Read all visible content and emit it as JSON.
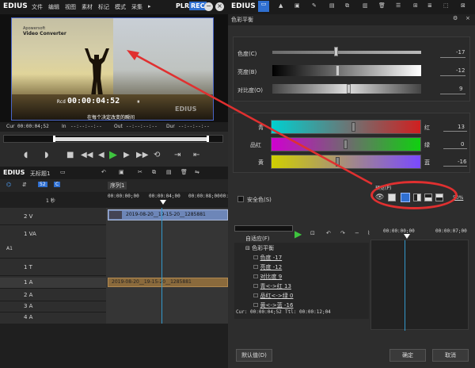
{
  "left_menu": {
    "brand": "EDIUS",
    "items": [
      "文件",
      "编辑",
      "视图",
      "素材",
      "标记",
      "模式",
      "采集"
    ],
    "more": "▸",
    "plr": "PLR",
    "rec": "REC"
  },
  "preview": {
    "wm1": "Apowersoft",
    "wm2": "Video Converter",
    "subtitle": "在每个决定改变的瞬间",
    "rcd": "Rcd",
    "tc": "00:00:04:52",
    "pause": "⏸",
    "logo": "EDIUS"
  },
  "timecodes": {
    "cur_l": "Cur",
    "cur": "00:00:04;52",
    "in_l": "In",
    "in": "--:--:--:--",
    "out_l": "Out",
    "out": "--:--:--:--",
    "dur_l": "Dur",
    "dur": "--:--:--:--"
  },
  "tl": {
    "brand": "EDIUS",
    "name": "无标题1",
    "seq": "序列1",
    "scale": "1 秒",
    "r0": "00:00:00;00",
    "r1": "00:00:04;00",
    "r2": "00:00:08;00",
    "r3": "00:00:12;00",
    "tracks": [
      {
        "n": "2 V"
      },
      {
        "n": "1 VA",
        "a": "A1"
      },
      {
        "n": "1 T"
      },
      {
        "n": "1 A"
      },
      {
        "n": "2 A"
      },
      {
        "n": "3 A"
      },
      {
        "n": "4 A"
      }
    ],
    "clip_v": "2019-08-20__19-15-20__1285881",
    "clip_a": "2019-08-20__19-15-20__1285881"
  },
  "right_menu": {
    "brand": "EDIUS"
  },
  "dlg": {
    "title": "色彩平衡",
    "sliders": [
      {
        "label": "色度(C)",
        "val": "-17"
      },
      {
        "label": "亮度(B)",
        "val": "-12"
      },
      {
        "label": "对比度(O)",
        "val": "9"
      }
    ],
    "balance": [
      {
        "left": "青",
        "right": "红",
        "val": "13"
      },
      {
        "left": "品红",
        "right": "绿",
        "val": "0"
      },
      {
        "left": "黄",
        "right": "蓝",
        "val": "-16"
      }
    ],
    "safe": "安全色(S)",
    "preview_label": "预览(P)",
    "pct": "50%",
    "auto": "自适应(F)",
    "t0": "00:00:00;00",
    "t1": "00:00:07;00",
    "tree": [
      "色彩平衡",
      "色度 -17",
      "亮度 -12",
      "对比度 9",
      "青<->红 13",
      "品红<->绿 0",
      "黄<->蓝 -16"
    ],
    "cur": "Cur: 00:00:04;52",
    "ttl": "Ttl: 00:00:12;04",
    "default": "默认值(D)",
    "ok": "确定",
    "cancel": "取消"
  },
  "colors": {
    "accent": "#2f6fd0",
    "highlight": "#e03030"
  }
}
